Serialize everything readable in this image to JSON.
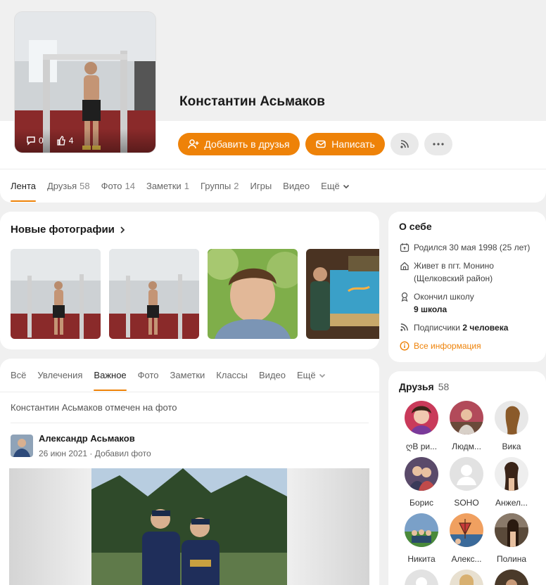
{
  "profile": {
    "name": "Константин Асьмаков",
    "comments_count": "0",
    "likes_count": "4"
  },
  "actions": {
    "add_friend_label": "Добавить в друзья",
    "message_label": "Написать"
  },
  "main_tabs": [
    {
      "label": "Лента",
      "count": ""
    },
    {
      "label": "Друзья",
      "count": "58"
    },
    {
      "label": "Фото",
      "count": "14"
    },
    {
      "label": "Заметки",
      "count": "1"
    },
    {
      "label": "Группы",
      "count": "2"
    },
    {
      "label": "Игры",
      "count": ""
    },
    {
      "label": "Видео",
      "count": ""
    },
    {
      "label": "Ещё",
      "count": ""
    }
  ],
  "photos": {
    "title": "Новые фотографии"
  },
  "feed": {
    "tabs": [
      "Всё",
      "Увлечения",
      "Важное",
      "Фото",
      "Заметки",
      "Классы",
      "Видео",
      "Ещё"
    ],
    "note": "Константин Асьмаков отмечен на фото",
    "post": {
      "author": "Александр Асьмаков",
      "date": "26 июн 2021",
      "action": "Добавил фото"
    }
  },
  "about": {
    "title": "О себе",
    "birth": "Родился 30 мая 1998 (25 лет)",
    "lives_line1": "Живет в пгт. Монино",
    "lives_line2": "(Щелковский район)",
    "school_line1": "Окончил школу",
    "school_line2": "9 школа",
    "subscribers_prefix": "Подписчики",
    "subscribers_value": "2 человека",
    "all_info": "Все информация"
  },
  "friends": {
    "title": "Друзья",
    "count": "58",
    "items": [
      {
        "name": "ღВ ри..."
      },
      {
        "name": "Людм..."
      },
      {
        "name": "Вика"
      },
      {
        "name": "Борис"
      },
      {
        "name": "SOHO"
      },
      {
        "name": "Анжел..."
      },
      {
        "name": "Никита"
      },
      {
        "name": "Алекс..."
      },
      {
        "name": "Полина"
      }
    ]
  },
  "colors": {
    "accent": "#ee8208",
    "background": "#f0f0f0"
  }
}
